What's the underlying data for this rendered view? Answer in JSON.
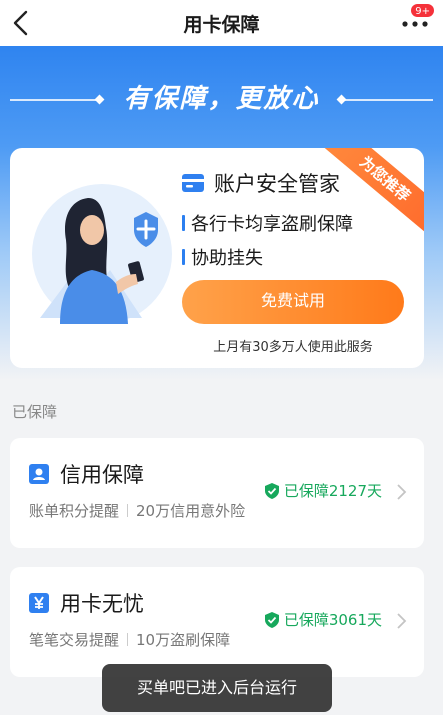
{
  "header": {
    "title": "用卡保障",
    "badge": "9+"
  },
  "hero": {
    "slogan": "有保障，更放心"
  },
  "promo": {
    "ribbon": "为您推荐",
    "title": "账户安全管家",
    "features": [
      "各行卡均享盗刷保障",
      "协助挂失"
    ],
    "button": "免费试用",
    "users_note": "上月有30多万人使用此服务"
  },
  "section_label": "已保障",
  "cards": [
    {
      "icon": "person-icon",
      "name": "信用保障",
      "tags": [
        "账单积分提醒",
        "20万信用意外险"
      ],
      "status": "已保障2127天"
    },
    {
      "icon": "yen-icon",
      "name": "用卡无忧",
      "tags": [
        "笔笔交易提醒",
        "10万盗刷保障"
      ],
      "status": "已保障3061天"
    }
  ],
  "toast": "买单吧已进入后台运行",
  "colors": {
    "accent_blue": "#2f80f0",
    "orange": "#ff7a1a",
    "success_green": "#17a85c",
    "badge_red": "#f5313a"
  }
}
